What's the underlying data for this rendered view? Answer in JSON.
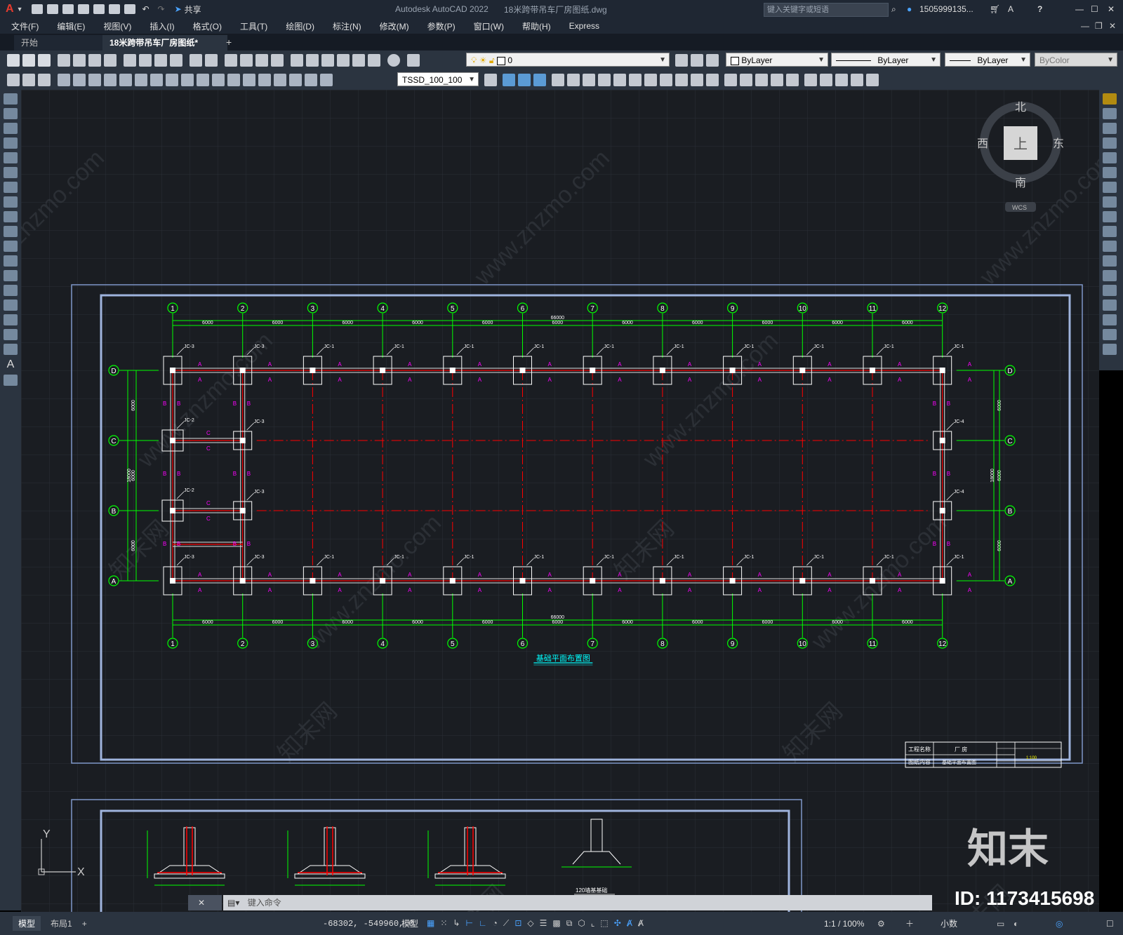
{
  "app": {
    "title": "Autodesk AutoCAD 2022",
    "file_name": "18米跨带吊车厂房图纸.dwg",
    "share_label": "共享",
    "search_placeholder": "键入关键字或短语",
    "user": "1505999135...",
    "help": "?"
  },
  "menu": [
    "文件(F)",
    "编辑(E)",
    "视图(V)",
    "插入(I)",
    "格式(O)",
    "工具(T)",
    "绘图(D)",
    "标注(N)",
    "修改(M)",
    "参数(P)",
    "窗口(W)",
    "帮助(H)",
    "Express"
  ],
  "tabs": {
    "start": "开始",
    "active": "18米跨带吊车厂房图纸*",
    "add": "+"
  },
  "toolbar": {
    "layer_value": "0",
    "color_value": "ByLayer",
    "linetype_value": "ByLayer",
    "lineweight_value": "ByLayer",
    "plotstyle_value": "ByColor",
    "dimstyle_value": "TSSD_100_100"
  },
  "viewcube": {
    "north": "北",
    "south": "南",
    "east": "东",
    "west": "西",
    "top": "上",
    "wcs": "WCS"
  },
  "drawing": {
    "grid_numbers": [
      "1",
      "2",
      "3",
      "4",
      "5",
      "6",
      "7",
      "8",
      "9",
      "10",
      "11",
      "12"
    ],
    "grid_letters": [
      "D",
      "C",
      "B",
      "A"
    ],
    "bay_dim": "6000",
    "total_dim": "66000",
    "span_dim": "18000",
    "plan_title": "基础平面布置图",
    "footing_label": "JC-1",
    "footing_labels": [
      "JC-2",
      "JC-3",
      "JC-4"
    ],
    "section_tags": [
      "A",
      "B",
      "C"
    ],
    "title_block": {
      "project_label": "工程名称",
      "project_value": "厂 房",
      "content_label": "图纸内容",
      "content_value": "基础平面布置图",
      "scale": "1:100"
    },
    "detail_caption": "120墙基基础"
  },
  "ucs": {
    "x": "X",
    "y": "Y"
  },
  "command_placeholder": "键入命令",
  "layout_tabs": [
    "模型",
    "布局1",
    "+"
  ],
  "status": {
    "coords": "-68302, -549960, 0",
    "space": "模型",
    "scale": "1:1 / 100%",
    "units": "小数"
  },
  "watermark": {
    "brand": "知末",
    "id": "ID: 1173415698",
    "url": "www.znzmo.com",
    "site": "知末网"
  },
  "colors": {
    "canvas": "#1a1d22",
    "grid_green": "#00ff00",
    "axis_red": "#ff0000",
    "footing_white": "#ffffff",
    "magenta": "#ff00ff",
    "frame_blue": "#7f98c9",
    "ui_dark": "#2b3440"
  }
}
